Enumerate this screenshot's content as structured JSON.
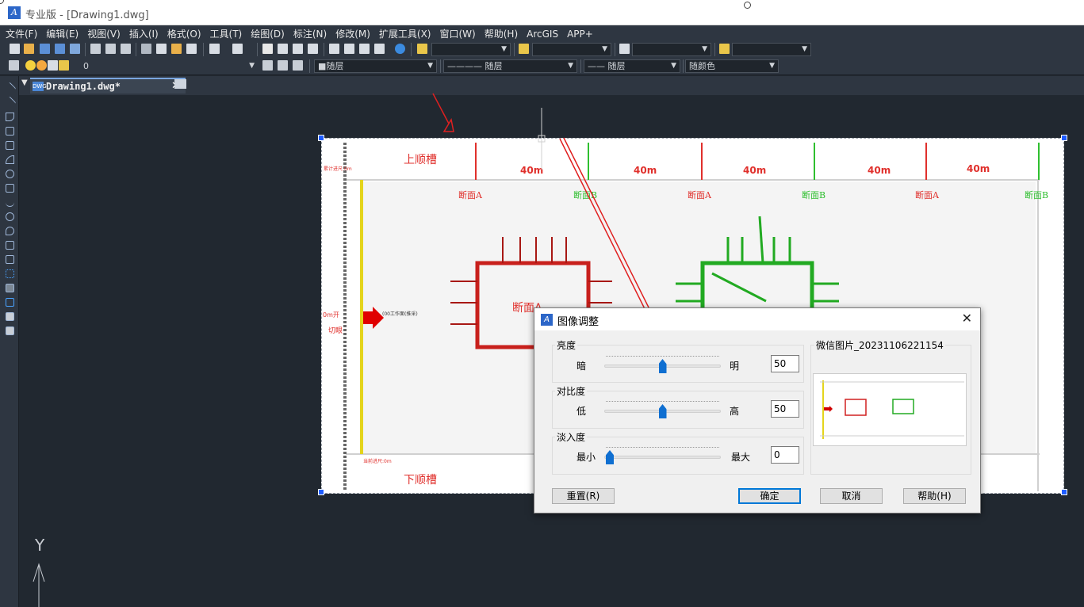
{
  "window": {
    "title": "专业版 - [Drawing1.dwg]",
    "logo_text": "A"
  },
  "menu": [
    "文件(F)",
    "编辑(E)",
    "视图(V)",
    "插入(I)",
    "格式(O)",
    "工具(T)",
    "绘图(D)",
    "标注(N)",
    "修改(M)",
    "扩展工具(X)",
    "窗口(W)",
    "帮助(H)",
    "ArcGIS",
    "APP+"
  ],
  "toolbar": {
    "layer_value": "0",
    "color_value": "■随层",
    "linetype_value": "———— 随层",
    "lineweight_value": "—— 随层",
    "plotstyle_value": "随颜色"
  },
  "tab": {
    "label": "Drawing1.dwg*",
    "icon_text": "DWG",
    "close": "✕"
  },
  "drawing": {
    "top_label": "上顺槽",
    "bottom_label": "下顺槽",
    "left_side_label": "切眼",
    "left_side_top": "0m开",
    "distance_labels": [
      "40m",
      "40m",
      "40m",
      "40m",
      "40m"
    ],
    "section_labels": [
      "断面A",
      "断面B",
      "断面A",
      "断面B",
      "断面A",
      "断面B"
    ],
    "center_label": "断面A",
    "small_top_note": "累计进尺:0m",
    "small_bottom_note": "当前进尺:0m",
    "arrow_note": "(00工作面(推采)",
    "colors": {
      "red": "#e0302c",
      "green": "#2fbf2f",
      "yellow": "#f0e020"
    }
  },
  "ucs": {
    "y_label": "Y"
  },
  "dialog": {
    "title": "图像调整",
    "close": "✕",
    "brightness": {
      "group": "亮度",
      "min": "暗",
      "max": "明",
      "value": "50",
      "fraction": 0.5
    },
    "contrast": {
      "group": "对比度",
      "min": "低",
      "max": "高",
      "value": "50",
      "fraction": 0.5
    },
    "fade": {
      "group": "淡入度",
      "min": "最小",
      "max": "最大",
      "value": "0",
      "fraction": 0.0
    },
    "preview_title": "微信图片_20231106221154",
    "buttons": {
      "reset": "重置(R)",
      "ok": "确定",
      "cancel": "取消",
      "help": "帮助(H)"
    }
  }
}
